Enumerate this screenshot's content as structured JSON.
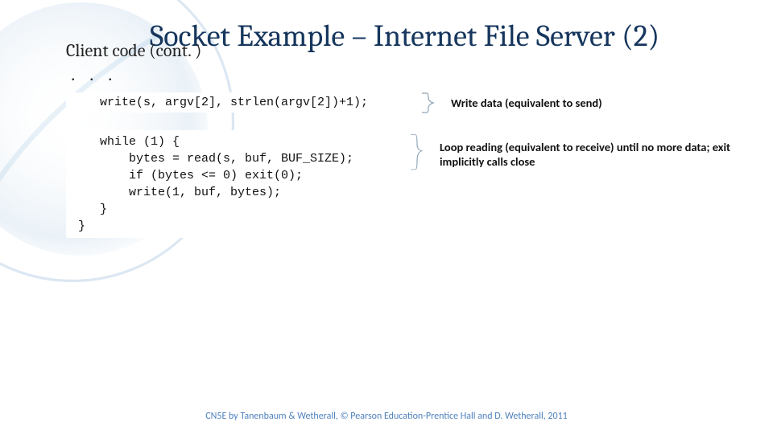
{
  "title": "Socket Example – Internet File Server (2)",
  "subtitle": "Client code (cont. )",
  "ellipsis": ". . .",
  "code_block_1": "    write(s, argv[2], strlen(argv[2])+1);",
  "note_1": "Write data (equivalent to send)",
  "code_block_2": "    while (1) {\n        bytes = read(s, buf, BUF_SIZE);\n        if (bytes <= 0) exit(0);\n        write(1, buf, bytes);\n    }\n }",
  "note_2": "Loop reading (equivalent to receive) until no more data; exit implicitly calls close",
  "footer": "CN5E by Tanenbaum & Wetherall, © Pearson Education-Prentice Hall and D. Wetherall, 2011"
}
